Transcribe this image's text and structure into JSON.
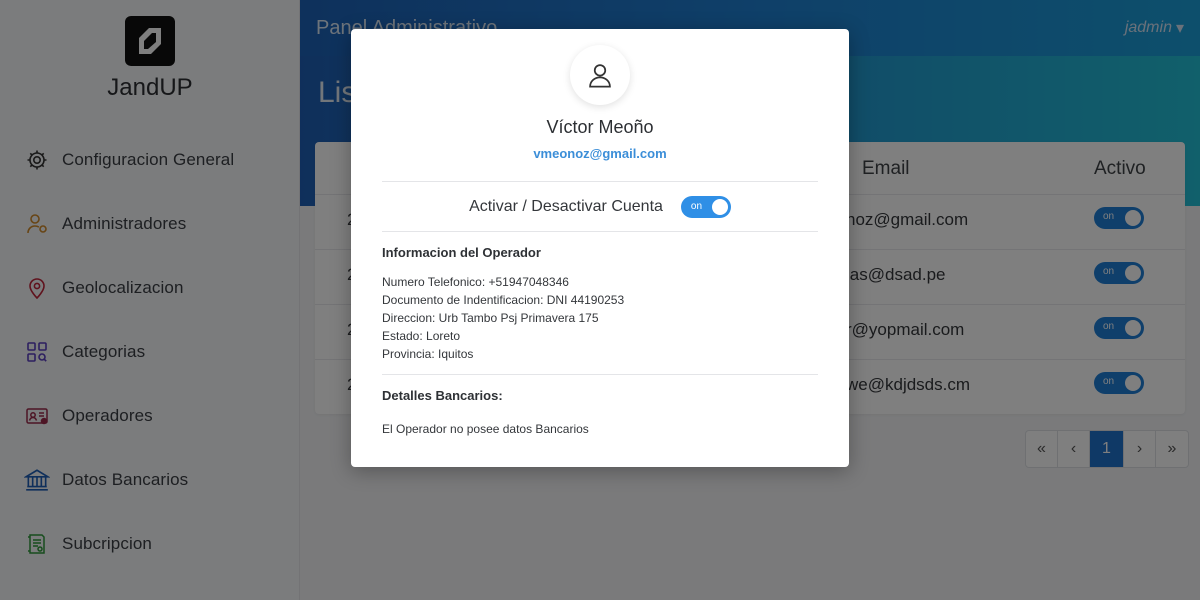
{
  "brand": {
    "name": "JandUP"
  },
  "sidebar": {
    "items": [
      {
        "label": "Configuracion General",
        "icon": "gear-icon"
      },
      {
        "label": "Administradores",
        "icon": "admin-user-icon"
      },
      {
        "label": "Geolocalizacion",
        "icon": "map-pin-icon"
      },
      {
        "label": "Categorias",
        "icon": "categories-grid-icon"
      },
      {
        "label": "Operadores",
        "icon": "id-card-icon"
      },
      {
        "label": "Datos Bancarios",
        "icon": "bank-icon"
      },
      {
        "label": "Subcripcion",
        "icon": "certificate-icon"
      }
    ]
  },
  "header": {
    "title": "Panel Administrativo",
    "user": "jadmin"
  },
  "page": {
    "title": "Lis"
  },
  "table": {
    "columns": {
      "email": "Email",
      "activo": "Activo"
    },
    "rows": [
      {
        "id": "2",
        "email": "noz@gmail.com",
        "toggle": "on"
      },
      {
        "id": "2",
        "email": "las@dsad.pe",
        "toggle": "on"
      },
      {
        "id": "2",
        "email": "r@yopmail.com",
        "toggle": "on"
      },
      {
        "id": "2",
        "email": "we@kdjdsds.cm",
        "toggle": "on"
      }
    ]
  },
  "pagination": {
    "first": "«",
    "prev": "‹",
    "current": "1",
    "next": "›",
    "last": "»"
  },
  "modal": {
    "name": "Víctor Meoño",
    "email": "vmeonoz@gmail.com",
    "toggle_label": "Activar / Desactivar Cuenta",
    "toggle_state": "on",
    "info_title": "Informacion del Operador",
    "info_lines": [
      "Numero Telefonico: +51947048346",
      "Documento de Indentificacion: DNI 44190253",
      "Direccion: Urb Tambo Psj Primavera 175",
      "Estado: Loreto",
      "Provincia: Iquitos"
    ],
    "bank_title": "Detalles Bancarios:",
    "bank_text": "El Operador no posee datos Bancarios"
  },
  "colors": {
    "accent": "#1f72cc",
    "toggle": "#2f8fe6",
    "link": "#3b8ed8"
  }
}
